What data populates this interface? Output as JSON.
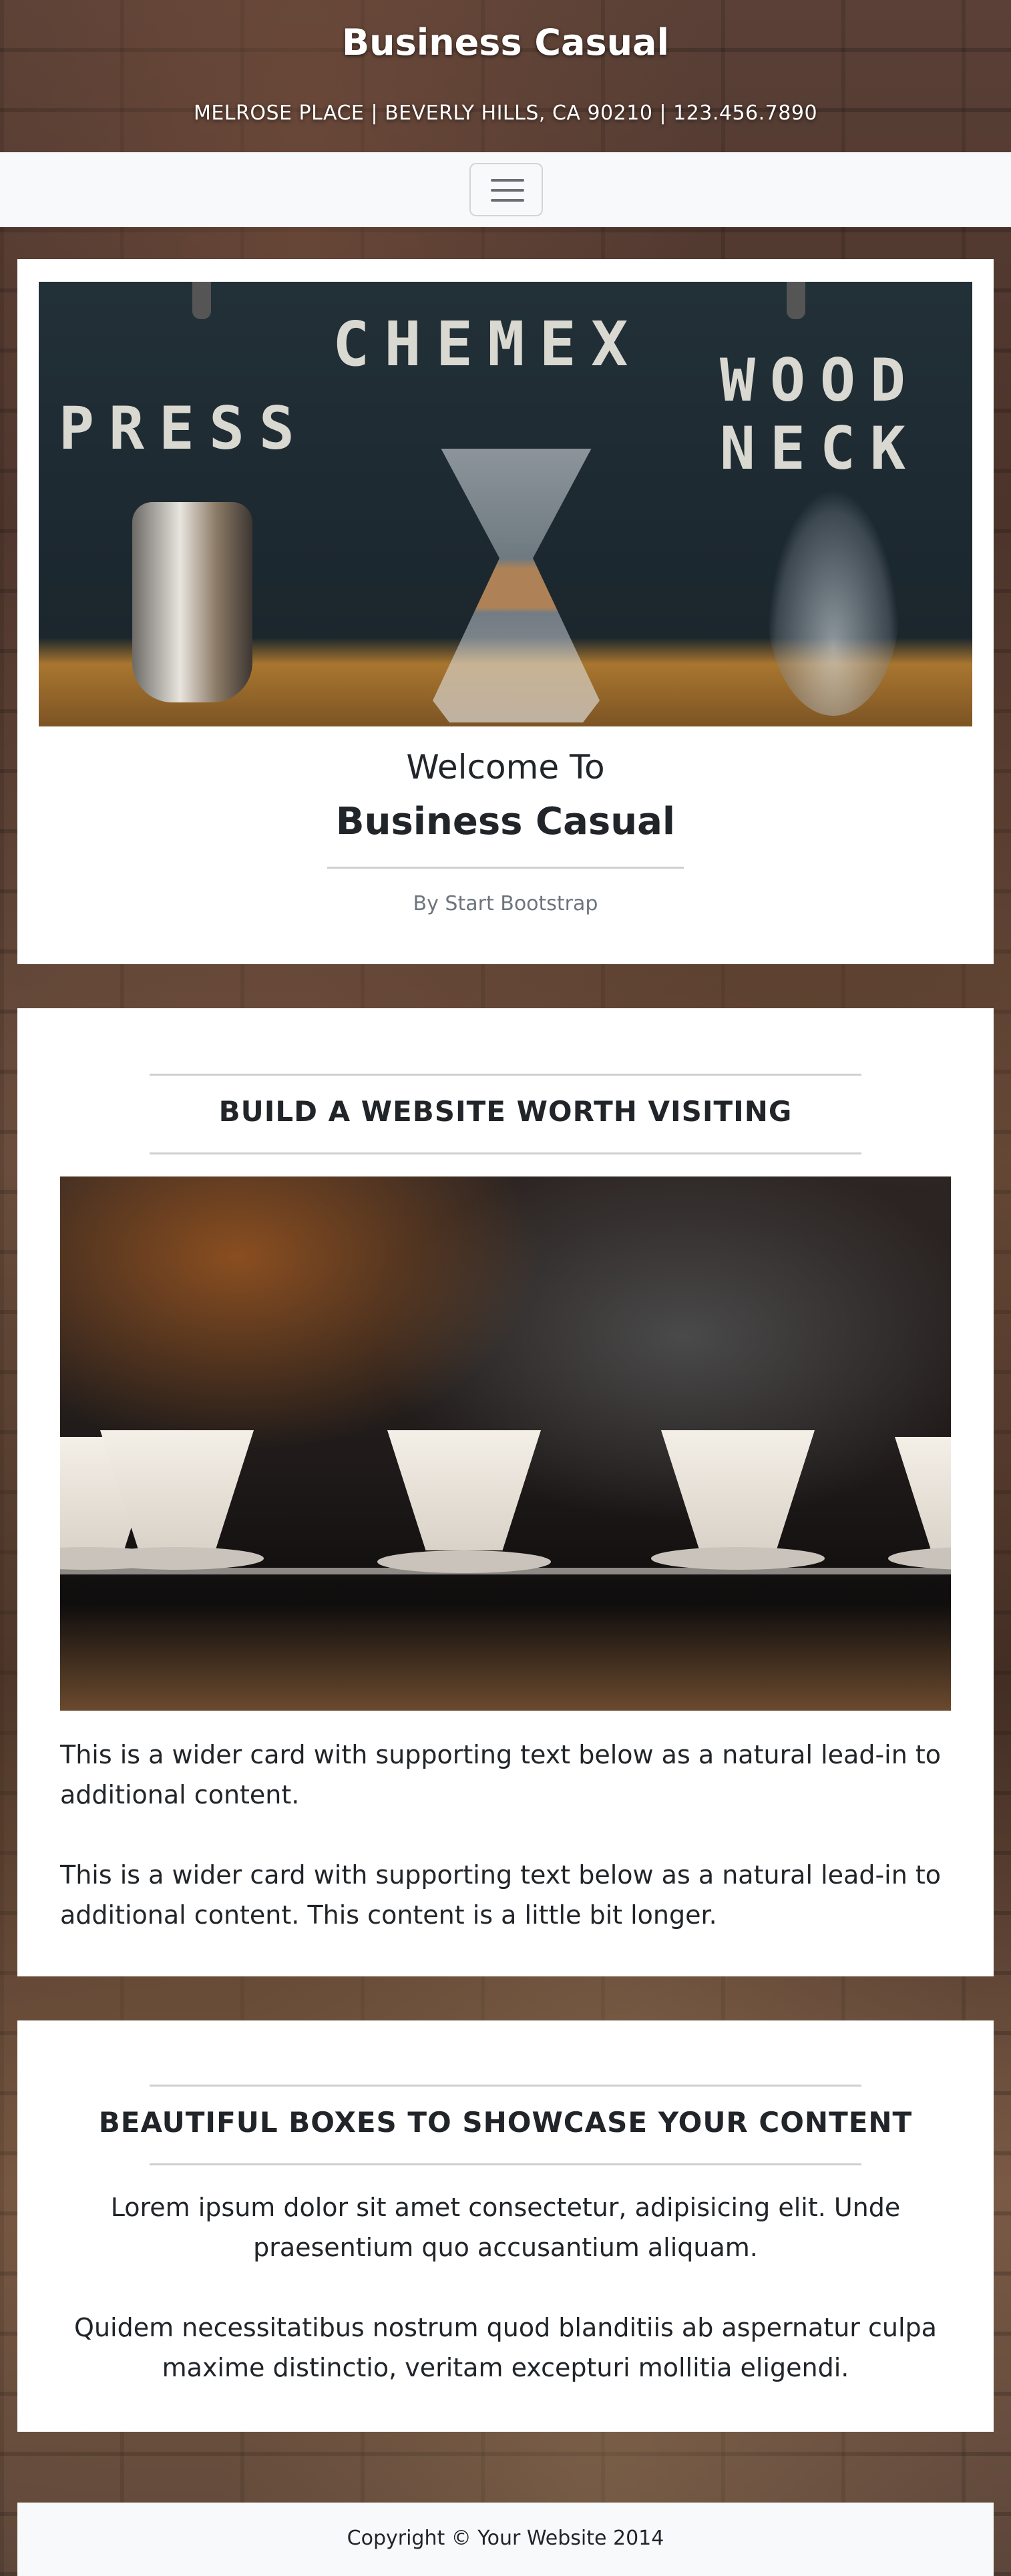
{
  "header": {
    "title": "Business Casual",
    "subtitle": "MELROSE PLACE | BEVERLY HILLS, CA 90210 | 123.456.7890"
  },
  "navbar": {
    "toggler_icon": "hamburger-menu-icon"
  },
  "hero": {
    "image_words": [
      "CHEMEX",
      "PRESS",
      "WOOD",
      "NECK"
    ],
    "welcome": "Welcome To",
    "brand": "Business Casual",
    "byline": "By Start Bootstrap"
  },
  "about": {
    "heading": "BUILD A WEBSITE WORTH VISITING",
    "paragraphs": [
      "This is a wider card with supporting text below as a natural lead-in to additional content.",
      "This is a wider card with supporting text below as a natural lead-in to additional content. This content is a little bit longer."
    ]
  },
  "boxes": {
    "heading": "BEAUTIFUL BOXES TO SHOWCASE YOUR CONTENT",
    "paragraphs": [
      "Lorem ipsum dolor sit amet consectetur, adipisicing elit. Unde praesentium quo accusantium aliquam.",
      "Quidem necessitatibus nostrum quod blanditiis ab aspernatur culpa maxime distinctio, veritam excepturi mollitia eligendi."
    ]
  },
  "footer": {
    "copyright": "Copyright © Your Website 2014"
  }
}
